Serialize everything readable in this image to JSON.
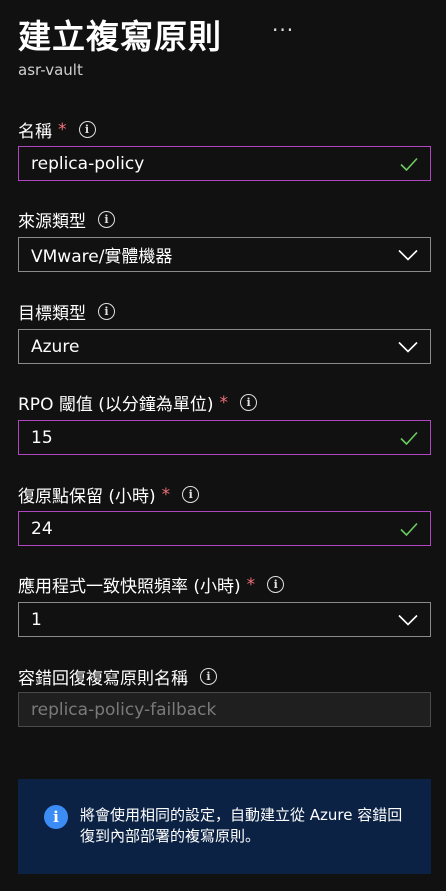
{
  "header": {
    "title": "建立複寫原則",
    "more": "···",
    "subtitle": "asr-vault"
  },
  "fields": {
    "name": {
      "label": "名稱",
      "required": "*",
      "value": "replica-policy"
    },
    "source_type": {
      "label": "來源類型",
      "value": "VMware/實體機器"
    },
    "target_type": {
      "label": "目標類型",
      "value": "Azure"
    },
    "rpo": {
      "label": "RPO 閾值 (以分鐘為單位)",
      "required": "*",
      "value": "15"
    },
    "retention": {
      "label": "復原點保留 (小時)",
      "required": "*",
      "value": "24"
    },
    "app_snapshot": {
      "label": "應用程式一致快照頻率 (小時)",
      "required": "*",
      "value": "1"
    },
    "failback_name": {
      "label": "容錯回復複寫原則名稱",
      "value": "replica-policy-failback"
    }
  },
  "info_icon_glyph": "i",
  "banner": {
    "icon": "i",
    "text": "將會使用相同的設定，自動建立從 Azure 容錯回復到內部部署的複寫原則。"
  },
  "colors": {
    "background": "#111112",
    "valid_border": "#b146c2",
    "check": "#6ccb5f",
    "required": "#f1707b",
    "banner_bg": "#0b2245",
    "banner_icon": "#3c8cf5"
  }
}
